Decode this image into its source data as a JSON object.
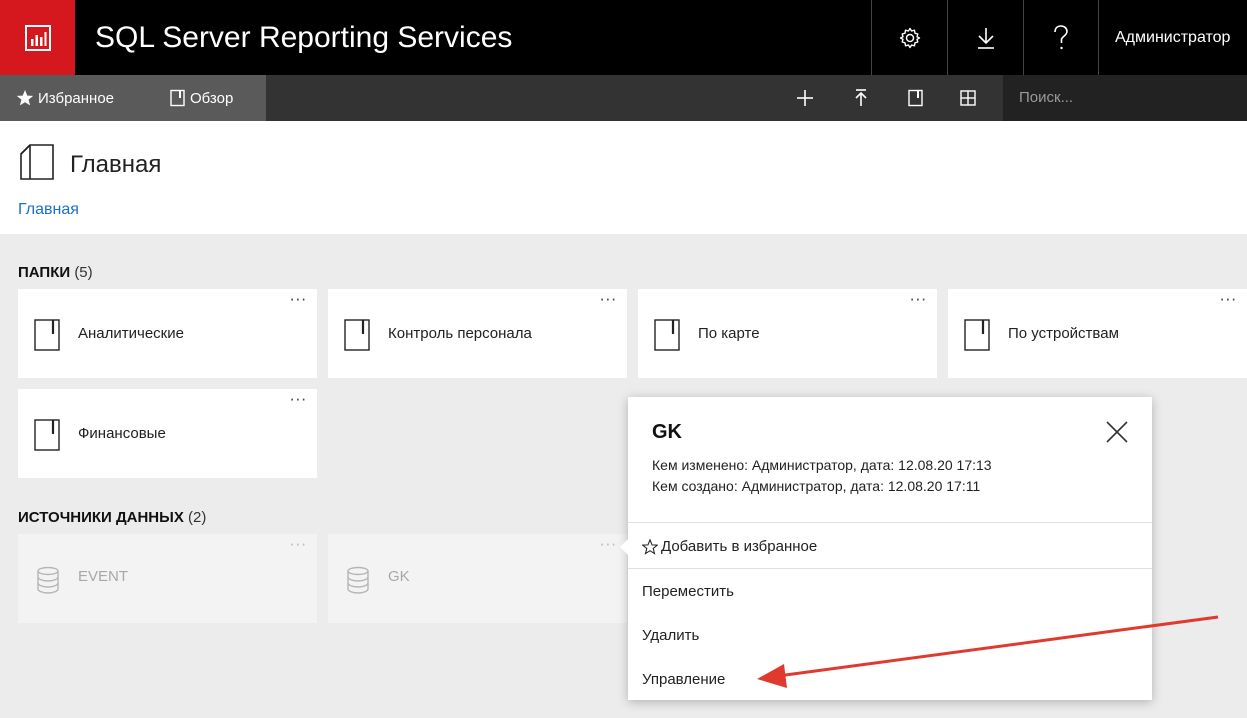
{
  "header": {
    "app_title": "SQL Server Reporting Services",
    "user": "Администратор"
  },
  "nav": {
    "favorites": "Избранное",
    "browse": "Обзор",
    "search_placeholder": "Поиск..."
  },
  "page": {
    "title": "Главная",
    "breadcrumb": "Главная"
  },
  "folders": {
    "title": "ПАПКИ",
    "count": "(5)",
    "items": [
      {
        "label": "Аналитические"
      },
      {
        "label": "Контроль персонала"
      },
      {
        "label": "По карте"
      },
      {
        "label": "По устройствам"
      },
      {
        "label": "Финансовые"
      }
    ]
  },
  "datasources": {
    "title": "ИСТОЧНИКИ ДАННЫХ",
    "count": "(2)",
    "items": [
      {
        "label": "EVENT"
      },
      {
        "label": "GK"
      }
    ]
  },
  "popup": {
    "title": "GK",
    "modified": "Кем изменено: Администратор, дата: 12.08.20 17:13",
    "created": "Кем создано: Администратор, дата: 12.08.20 17:11",
    "add_favorite": "Добавить в избранное",
    "move": "Переместить",
    "delete": "Удалить",
    "manage": "Управление"
  },
  "tile_more": "···",
  "colors": {
    "logo_red": "#d4181e",
    "link_blue": "#1a6fd0",
    "annotation_red": "#e03a2e"
  }
}
